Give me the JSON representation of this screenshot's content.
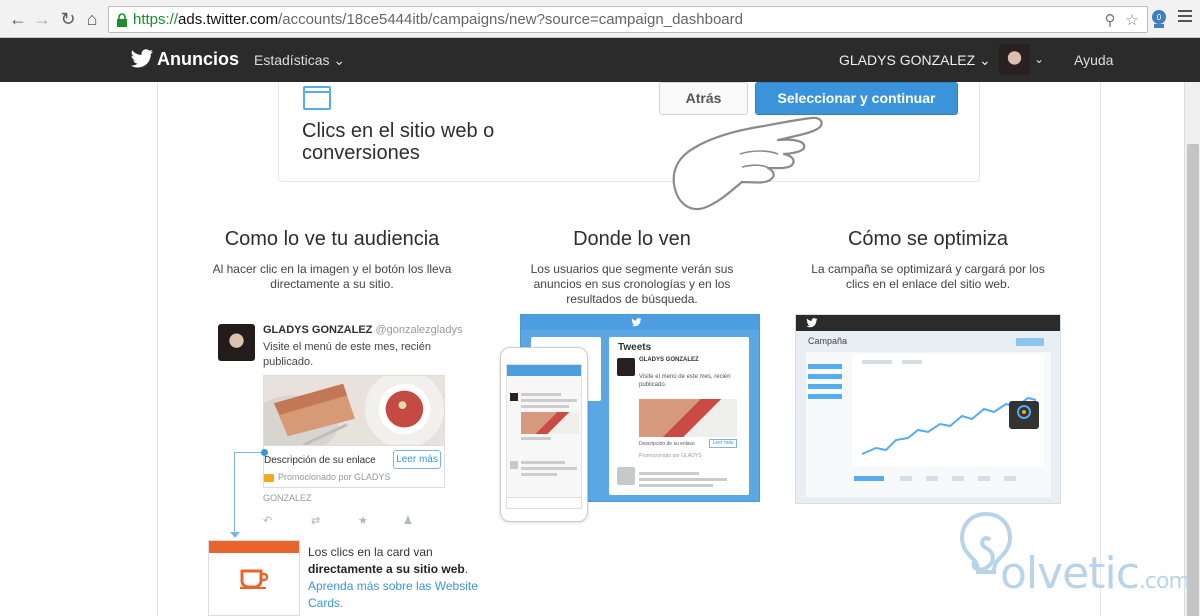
{
  "browser": {
    "url_scheme": "https://",
    "url_host": "ads.twitter.com",
    "url_path": "/accounts/18ce5444itb/campaigns/new?source=campaign_dashboard"
  },
  "nav": {
    "brand": "Anuncios",
    "stats_menu": "Estadísticas",
    "user_name": "GLADYS GONZALEZ",
    "help": "Ayuda"
  },
  "objective": {
    "title": "Clics en el sitio web o conversiones",
    "back_label": "Atrás",
    "continue_label": "Seleccionar y continuar"
  },
  "columns": [
    {
      "title": "Como lo ve tu audiencia",
      "description": "Al hacer clic en la imagen y el botón los lleva directamente a su sitio."
    },
    {
      "title": "Donde lo ven",
      "description": "Los usuarios que segmente verán sus anuncios en sus cronologías y en los resultados de búsqueda."
    },
    {
      "title": "Cómo se optimiza",
      "description": "La campaña se optimizará y cargará por los clics en el enlace del sitio web."
    }
  ],
  "tweet": {
    "name": "GLADYS GONZALEZ",
    "handle": "@gonzalezgladys",
    "text": "Visite el menú de este mes, recién publicado.",
    "card_description": "Descripción de su enlace",
    "read_more": "Leer más",
    "promoted": "Promocionado por GLADYS",
    "promoted_name": "GONZALEZ"
  },
  "clicks": {
    "intro": "Los clics en la card van",
    "bold": "directamente a su sitio web",
    "link": "Aprenda más sobre las Website Cards."
  },
  "preview": {
    "tweets_title": "Tweets",
    "tweet_name": "GLADYS GONZALEZ",
    "tweet_text": "Visite el menú de este mes, recién publicado.",
    "card_description": "Descripción de su enlace",
    "read_more": "Leer más",
    "promoted": "Promocionado por GLADYS"
  },
  "optimize": {
    "campaign_label": "Campaña"
  },
  "watermark": {
    "text": "olvetic",
    "suffix": ".com"
  },
  "colors": {
    "twitter_blue": "#55acee",
    "button_blue": "#3b94d9",
    "nav_bg": "#2b2b2b"
  }
}
